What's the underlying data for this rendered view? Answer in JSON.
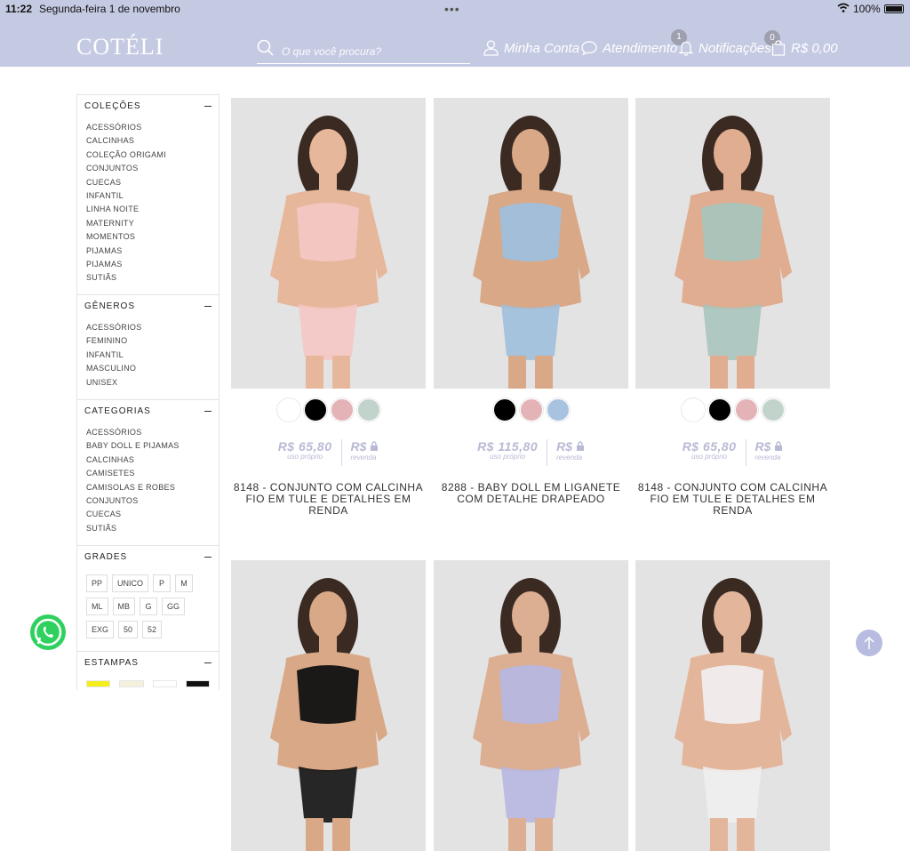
{
  "status_bar": {
    "time": "11:22",
    "date": "Segunda-feira 1 de novembro",
    "battery": "100%"
  },
  "header": {
    "logo": "COTÉLI",
    "search_placeholder": "O que você procura?",
    "account": "Minha Conta",
    "support": "Atendimento",
    "notifications": "Notificações",
    "notifications_count": "1",
    "cart_count": "0",
    "cart_total": "R$ 0,00"
  },
  "sidebar": {
    "colecoes": {
      "title": "COLEÇÕES",
      "items": [
        "ACESSÓRIOS",
        "CALCINHAS",
        "COLEÇÃO ORIGAMI",
        "CONJUNTOS",
        "CUECAS",
        "INFANTIL",
        "LINHA NOITE",
        "MATERNITY",
        "MOMENTOS",
        "PIJAMAS",
        "PIJAMAS",
        "SUTIÃS"
      ]
    },
    "generos": {
      "title": "GÊNEROS",
      "items": [
        "ACESSÓRIOS",
        "FEMININO",
        "INFANTIL",
        "MASCULINO",
        "UNISEX"
      ]
    },
    "categorias": {
      "title": "CATEGORIAS",
      "items": [
        "ACESSÓRIOS",
        "BABY DOLL E PIJAMAS",
        "CALCINHAS",
        "CAMISETES",
        "CAMISOLAS E ROBES",
        "CONJUNTOS",
        "CUECAS",
        "SUTIÃS"
      ]
    },
    "grades": {
      "title": "GRADES",
      "sizes": [
        "PP",
        "UNICO",
        "P",
        "M",
        "ML",
        "MB",
        "G",
        "GG",
        "EXG",
        "50",
        "52"
      ]
    },
    "estampas": {
      "title": "ESTAMPAS",
      "colors": [
        "#f5ee1a",
        "#f4f0dc",
        "#ffffff",
        "#111111"
      ]
    }
  },
  "products": [
    {
      "title": "8148 - CONJUNTO COM CALCINHA FIO EM TULE E DETALHES EM RENDA",
      "price": "R$ 65,80",
      "price_label": "uso próprio",
      "resale": "R$",
      "resale_label": "revenda",
      "colors": [
        "#ffffff",
        "#000000",
        "#e3b3b8",
        "#c2d3cc"
      ],
      "skin": "#e6b79a",
      "outfit": "#f4c6c3"
    },
    {
      "title": "8288 - BABY DOLL EM LIGANETE COM DETALHE DRAPEADO",
      "price": "R$ 115,80",
      "price_label": "uso próprio",
      "resale": "R$",
      "resale_label": "revenda",
      "colors": [
        "#000000",
        "#e3b3b8",
        "#a8c3e0"
      ],
      "skin": "#d9a887",
      "outfit": "#9fbfdc"
    },
    {
      "title": "8148 - CONJUNTO COM CALCINHA FIO EM TULE E DETALHES EM RENDA",
      "price": "R$ 65,80",
      "price_label": "uso próprio",
      "resale": "R$",
      "resale_label": "revenda",
      "colors": [
        "#ffffff",
        "#000000",
        "#e3b3b8",
        "#c2d3cc"
      ],
      "skin": "#e0ad90",
      "outfit": "#a9c4bd"
    },
    {
      "title": "",
      "price": "",
      "colors": [],
      "skin": "#d9a887",
      "outfit": "#111111"
    },
    {
      "title": "",
      "price": "",
      "colors": [],
      "skin": "#dcae92",
      "outfit": "#b7b7e2"
    },
    {
      "title": "",
      "price": "",
      "colors": [],
      "skin": "#e3b69c",
      "outfit": "#f0eeee"
    }
  ]
}
